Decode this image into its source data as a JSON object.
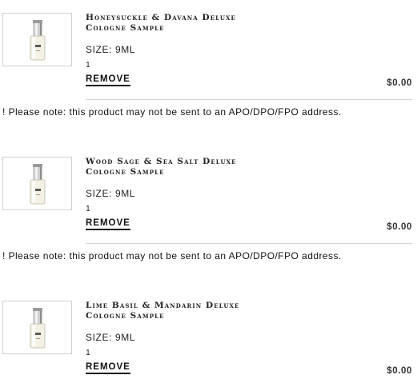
{
  "items": [
    {
      "name_line1": "Honeysuckle & Davana Deluxe",
      "name_line2": "Cologne Sample",
      "size": "SIZE: 9ML",
      "quantity": "1",
      "remove_label": "REMOVE",
      "price": "$0.00",
      "note": "! Please note: this product may not be sent to an APO/DPO/FPO address.",
      "image_icon": "cologne-bottle-icon"
    },
    {
      "name_line1": "Wood Sage & Sea Salt Deluxe",
      "name_line2": "Cologne Sample",
      "size": "SIZE: 9ML",
      "quantity": "1",
      "remove_label": "REMOVE",
      "price": "$0.00",
      "note": "! Please note: this product may not be sent to an APO/DPO/FPO address.",
      "image_icon": "cologne-bottle-icon"
    },
    {
      "name_line1": "Lime Basil & Mandarin Deluxe",
      "name_line2": "Cologne Sample",
      "size": "SIZE: 9ML",
      "quantity": "1",
      "remove_label": "REMOVE",
      "price": "$0.00",
      "image_icon": "cologne-bottle-icon"
    }
  ]
}
